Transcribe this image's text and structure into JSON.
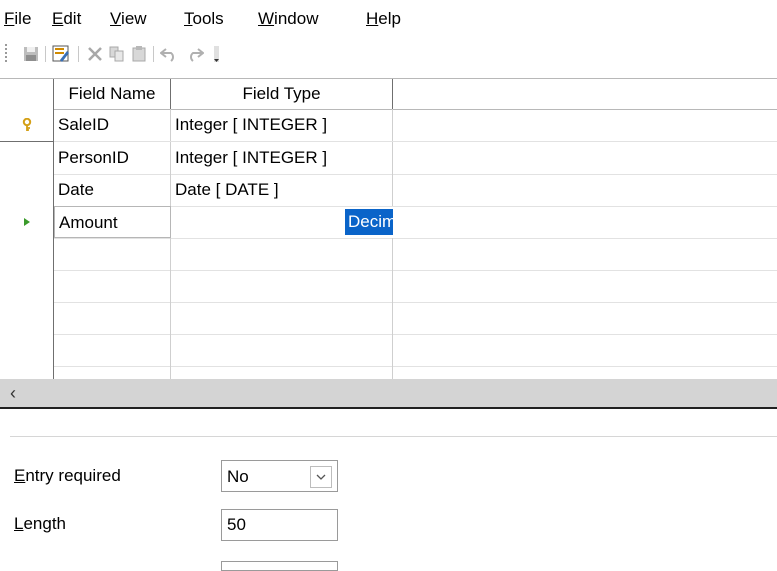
{
  "menu": {
    "file": {
      "u": "F",
      "rest": "ile"
    },
    "edit": {
      "u": "E",
      "rest": "dit"
    },
    "view": {
      "u": "V",
      "rest": "iew"
    },
    "tools": {
      "u": "T",
      "rest": "ools"
    },
    "window": {
      "u": "W",
      "rest": "indow"
    },
    "help": {
      "u": "H",
      "rest": "elp"
    }
  },
  "toolbar": {
    "icons": [
      "save-icon",
      "edit-icon",
      "cut-icon",
      "copy-icon",
      "paste-icon",
      "undo-icon",
      "redo-icon",
      "more-icon"
    ]
  },
  "table": {
    "headers": {
      "field_name": "Field Name",
      "field_type": "Field Type",
      "description": ""
    },
    "rows": [
      {
        "name": "SaleID",
        "type": "Integer [ INTEGER ]",
        "marker": "primary-key"
      },
      {
        "name": "PersonID",
        "type": "Integer [ INTEGER ]",
        "marker": ""
      },
      {
        "name": "Date",
        "type": "Date [ DATE ]",
        "marker": ""
      },
      {
        "name": "Amount",
        "type": "Decimal [ DECIMAL ]",
        "marker": "current-row"
      }
    ],
    "empty_rows": 4
  },
  "colors": {
    "selection": "#0a64c9",
    "key_icon": "#d4a017",
    "current_row_arrow": "#3a9a2a"
  },
  "properties": {
    "entry_required": {
      "u": "E",
      "rest": "ntry required",
      "value": "No"
    },
    "length": {
      "u": "L",
      "rest": "ength",
      "value": "50"
    }
  }
}
